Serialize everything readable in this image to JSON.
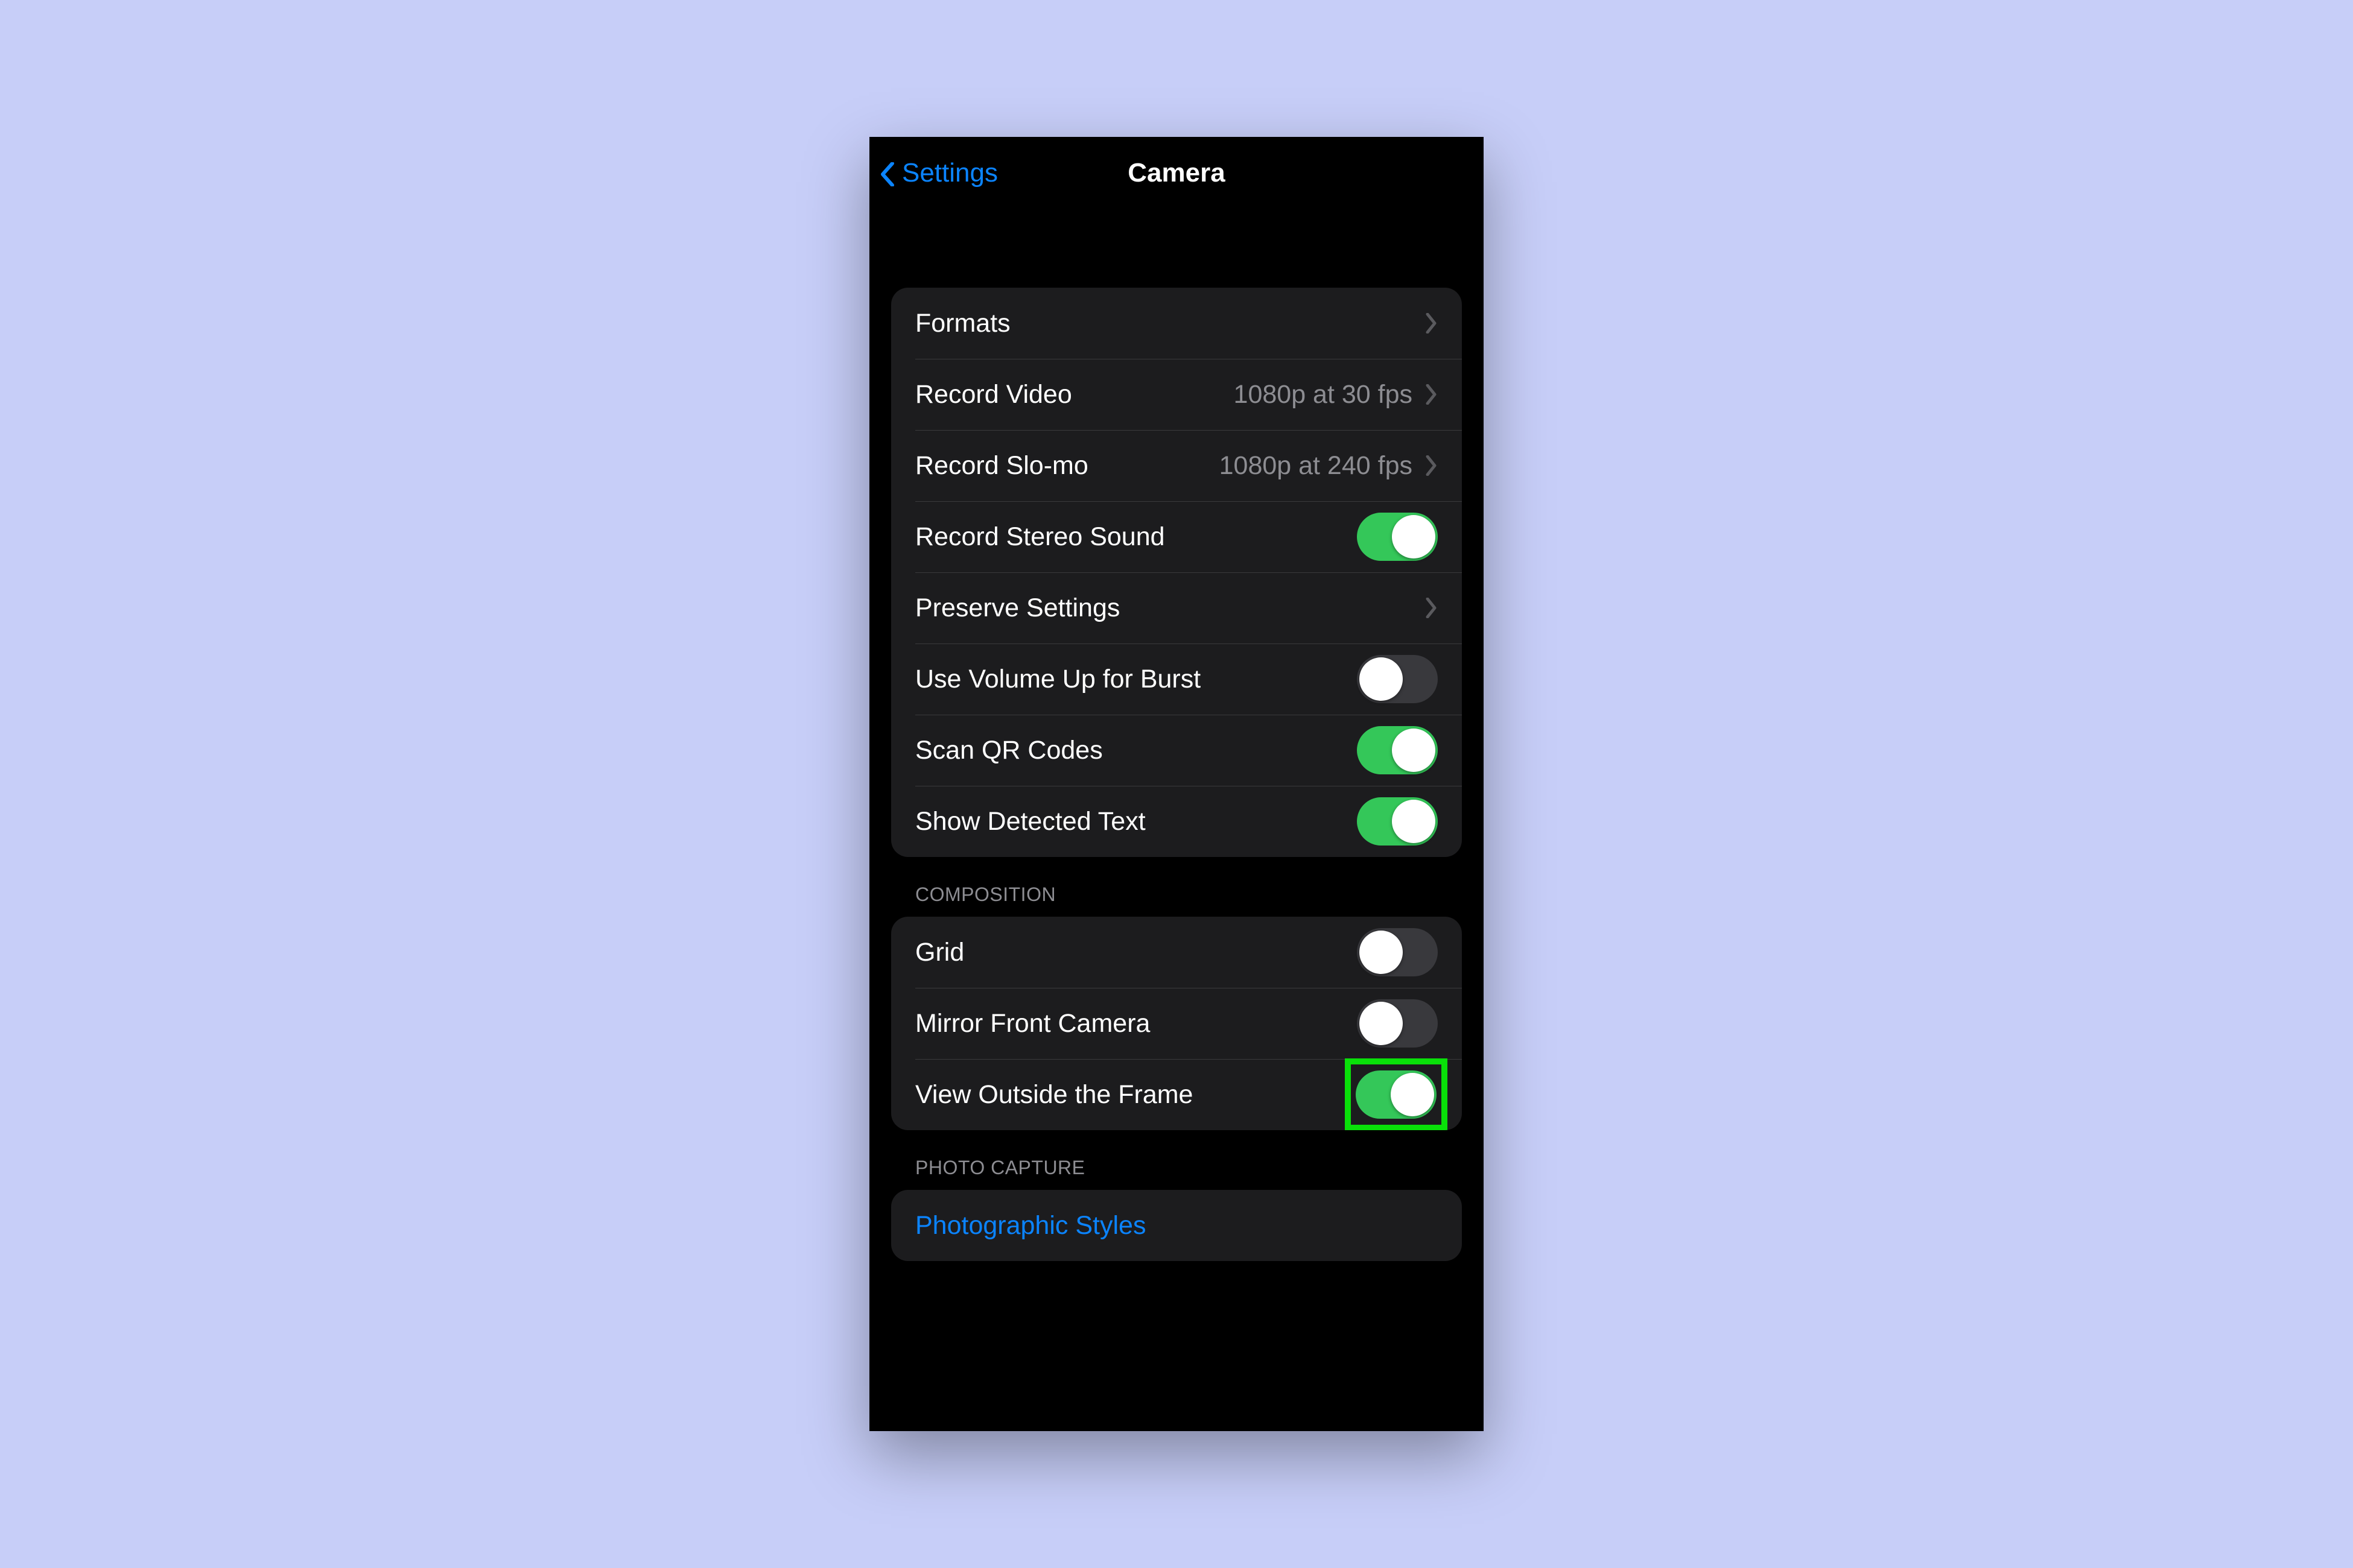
{
  "nav": {
    "back_label": "Settings",
    "title": "Camera"
  },
  "groups": {
    "main": {
      "formats": "Formats",
      "record_video": {
        "label": "Record Video",
        "value": "1080p at 30 fps"
      },
      "record_slomo": {
        "label": "Record Slo-mo",
        "value": "1080p at 240 fps"
      },
      "stereo_sound": {
        "label": "Record Stereo Sound",
        "on": true
      },
      "preserve": "Preserve Settings",
      "volume_burst": {
        "label": "Use Volume Up for Burst",
        "on": false
      },
      "scan_qr": {
        "label": "Scan QR Codes",
        "on": true
      },
      "detected_text": {
        "label": "Show Detected Text",
        "on": true
      }
    },
    "composition": {
      "header": "COMPOSITION",
      "grid": {
        "label": "Grid",
        "on": false
      },
      "mirror": {
        "label": "Mirror Front Camera",
        "on": false
      },
      "outside_frame": {
        "label": "View Outside the Frame",
        "on": true,
        "highlighted": true
      }
    },
    "photo_capture": {
      "header": "PHOTO CAPTURE",
      "styles": "Photographic Styles"
    }
  },
  "colors": {
    "accent": "#0b84ff",
    "toggle_on": "#34c759",
    "highlight": "#09e009"
  }
}
